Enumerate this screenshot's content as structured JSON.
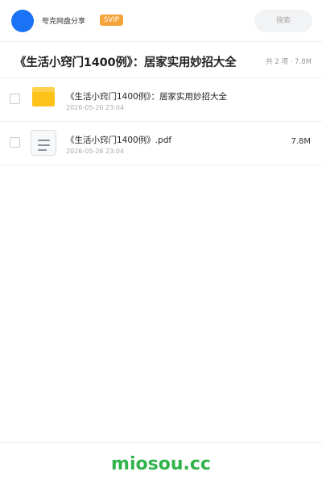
{
  "header": {
    "username": "夸克网盘分享",
    "badge": "SVIP",
    "search_label": "搜索"
  },
  "folder": {
    "title": "《生活小窍门1400例》：居家实用妙招大全",
    "summary": "共 2 项 · 7.8M"
  },
  "files": [
    {
      "name": "《生活小窍门1400例》：居家实用妙招大全",
      "date": "2026-05-26 23:04",
      "size": "",
      "icon": "folder-icon"
    },
    {
      "name": "《生活小窍门1400例》.pdf",
      "date": "2026-05-26 23:04",
      "size": "7.8M",
      "icon": "document-icon"
    }
  ],
  "footer": {
    "brand": "miosou.cc"
  },
  "colors": {
    "avatar": "#1a73f5",
    "badge": "#f5a33b",
    "folder": "#ffc21a",
    "brand": "#2fb34a"
  }
}
